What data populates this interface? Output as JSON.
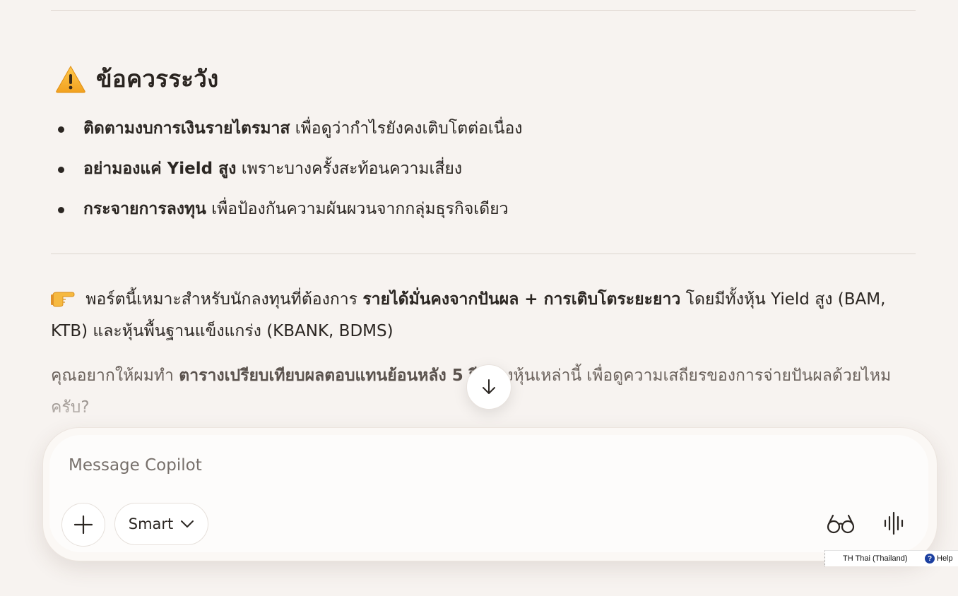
{
  "caution": {
    "heading": "ข้อควรระวัง",
    "items": [
      {
        "bold": "ติดตามงบการเงินรายไตรมาส",
        "text": " เพื่อดูว่ากำไรยังคงเติบโตต่อเนื่อง"
      },
      {
        "bold": "อย่ามองแค่ Yield สูง",
        "text": " เพราะบางครั้งสะท้อนความเสี่ยง"
      },
      {
        "bold": "กระจายการลงทุน",
        "text": " เพื่อป้องกันความผันผวนจากกลุ่มธุรกิจเดียว"
      }
    ]
  },
  "summary": {
    "part1": " พอร์ตนี้เหมาะสำหรับนักลงทุนที่ต้องการ ",
    "bold": "รายได้มั่นคงจากปันผล + การเติบโตระยะยาว",
    "part2": " โดยมีทั้งหุ้น Yield สูง (BAM, KTB) และหุ้นพื้นฐานแข็งแกร่ง (KBANK, BDMS)"
  },
  "question": {
    "part1": "คุณอยากให้ผมทำ ",
    "bold": "ตารางเปรียบเทียบผลตอบแทนย้อนหลัง 5 ปี",
    "part2": " ของหุ้นเหล่านี้ เพื่อดูความเสถียรของการจ่ายปันผลด้วยไหมครับ?"
  },
  "composer": {
    "placeholder": "Message Copilot",
    "mode_label": "Smart"
  },
  "taskbar": {
    "language": "TH Thai (Thailand)",
    "help": "Help"
  },
  "icons": {
    "warning": "warning-icon",
    "pointing_hand": "pointing-hand-icon",
    "scroll_down": "arrow-down-icon",
    "add": "plus-icon",
    "chevron": "chevron-down-icon",
    "vision": "glasses-icon",
    "voice": "voice-waveform-icon"
  }
}
